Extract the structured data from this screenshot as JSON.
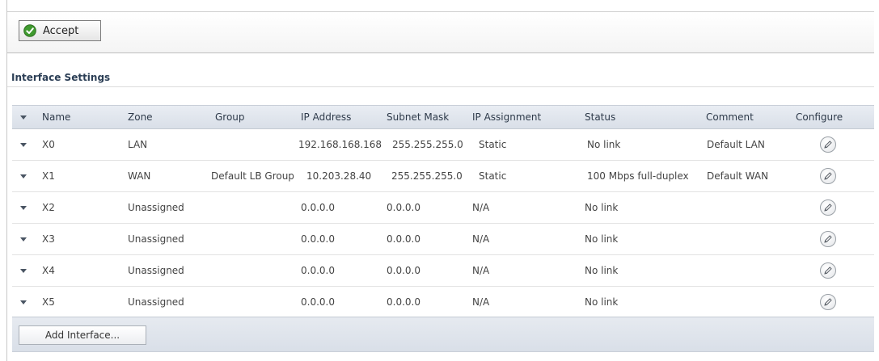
{
  "toolbar": {
    "accept_label": "Accept"
  },
  "section": {
    "title": "Interface Settings"
  },
  "table": {
    "columns": [
      "Name",
      "Zone",
      "Group",
      "IP Address",
      "Subnet Mask",
      "IP Assignment",
      "Status",
      "Comment",
      "Configure"
    ],
    "rows": [
      {
        "name": "X0",
        "zone": "LAN",
        "group": "",
        "ip": "192.168.168.168",
        "mask": "255.255.255.0",
        "assignment": "Static",
        "status": "No link",
        "comment": "Default LAN"
      },
      {
        "name": "X1",
        "zone": "WAN",
        "group": "Default LB Group",
        "ip": "10.203.28.40",
        "mask": "255.255.255.0",
        "assignment": "Static",
        "status": "100 Mbps full-duplex",
        "comment": "Default WAN"
      },
      {
        "name": "X2",
        "zone": "Unassigned",
        "group": "",
        "ip": "0.0.0.0",
        "mask": "0.0.0.0",
        "assignment": "N/A",
        "status": "No link",
        "comment": ""
      },
      {
        "name": "X3",
        "zone": "Unassigned",
        "group": "",
        "ip": "0.0.0.0",
        "mask": "0.0.0.0",
        "assignment": "N/A",
        "status": "No link",
        "comment": ""
      },
      {
        "name": "X4",
        "zone": "Unassigned",
        "group": "",
        "ip": "0.0.0.0",
        "mask": "0.0.0.0",
        "assignment": "N/A",
        "status": "No link",
        "comment": ""
      },
      {
        "name": "X5",
        "zone": "Unassigned",
        "group": "",
        "ip": "0.0.0.0",
        "mask": "0.0.0.0",
        "assignment": "N/A",
        "status": "No link",
        "comment": ""
      }
    ]
  },
  "footer": {
    "add_label": "Add Interface..."
  },
  "icons": {
    "accept": "check-circle-icon",
    "configure": "pencil-icon",
    "expand": "caret-down-icon"
  },
  "colors": {
    "accept_green": "#3f9a2e",
    "header_bg": "#dde3eb",
    "title_text": "#2b3e55"
  }
}
